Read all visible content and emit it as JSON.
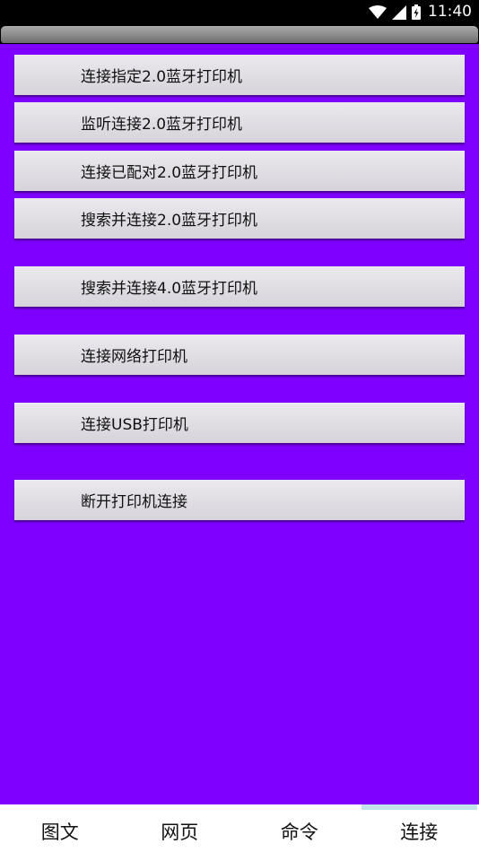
{
  "status_bar": {
    "time": "11:40",
    "icons": [
      "wifi-icon",
      "signal-icon",
      "battery-icon"
    ]
  },
  "colors": {
    "content_background": "#7f00ff",
    "button_background": "#e0dde3",
    "active_tab_indicator": "#c3e3ea"
  },
  "buttons": [
    {
      "label": "连接指定2.0蓝牙打印机"
    },
    {
      "label": "监听连接2.0蓝牙打印机"
    },
    {
      "label": "连接已配对2.0蓝牙打印机"
    },
    {
      "label": "搜索并连接2.0蓝牙打印机"
    },
    {
      "label": "搜索并连接4.0蓝牙打印机"
    },
    {
      "label": "连接网络打印机"
    },
    {
      "label": "连接USB打印机"
    },
    {
      "label": "断开打印机连接"
    }
  ],
  "bottom_nav": {
    "tabs": [
      {
        "label": "图文"
      },
      {
        "label": "网页"
      },
      {
        "label": "命令"
      },
      {
        "label": "连接"
      }
    ],
    "active": "连接"
  }
}
